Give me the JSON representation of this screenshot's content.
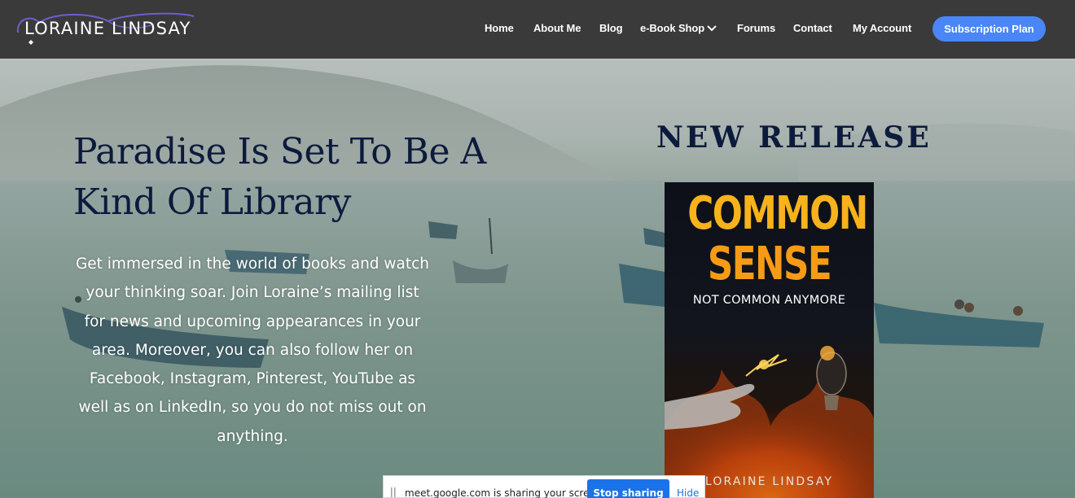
{
  "header": {
    "logo_text": "LORAINE LINDSAY",
    "nav": [
      {
        "label": "Home"
      },
      {
        "label": "About Me"
      },
      {
        "label": "Blog"
      },
      {
        "label": "e-Book Shop"
      },
      {
        "label": "Forums"
      },
      {
        "label": "Contact"
      },
      {
        "label": "My Account"
      }
    ],
    "subscribe_label": "Subscription Plan"
  },
  "hero": {
    "title": "Paradise Is Set To Be A Kind Of Library",
    "text": "Get immersed in the world of books and watch your thinking soar. Join Loraine’s mailing list for news and upcoming appearances in your area. Moreover, you can also follow her on Facebook, Instagram, Pinterest, YouTube as well as on LinkedIn, so you do not miss out on anything."
  },
  "release": {
    "heading": "NEW RELEASE",
    "book": {
      "title_line1": "COMMON",
      "title_line2": "SENSE",
      "subtitle": "NOT COMMON ANYMORE",
      "author": "LORAINE LINDSAY"
    }
  },
  "share_bar": {
    "message": "meet.google.com is sharing your screen.",
    "stop_label": "Stop sharing",
    "hide_label": "Hide"
  },
  "colors": {
    "header_bg": "#3a3a3a",
    "accent_button": "#4a86f7",
    "heading_navy": "#0c1b3c",
    "book_title_orange": "#f7b21c",
    "share_blue": "#1a73e8"
  },
  "icons": {
    "chevron": "chevron-down-icon",
    "grip": "drag-handle-icon"
  }
}
